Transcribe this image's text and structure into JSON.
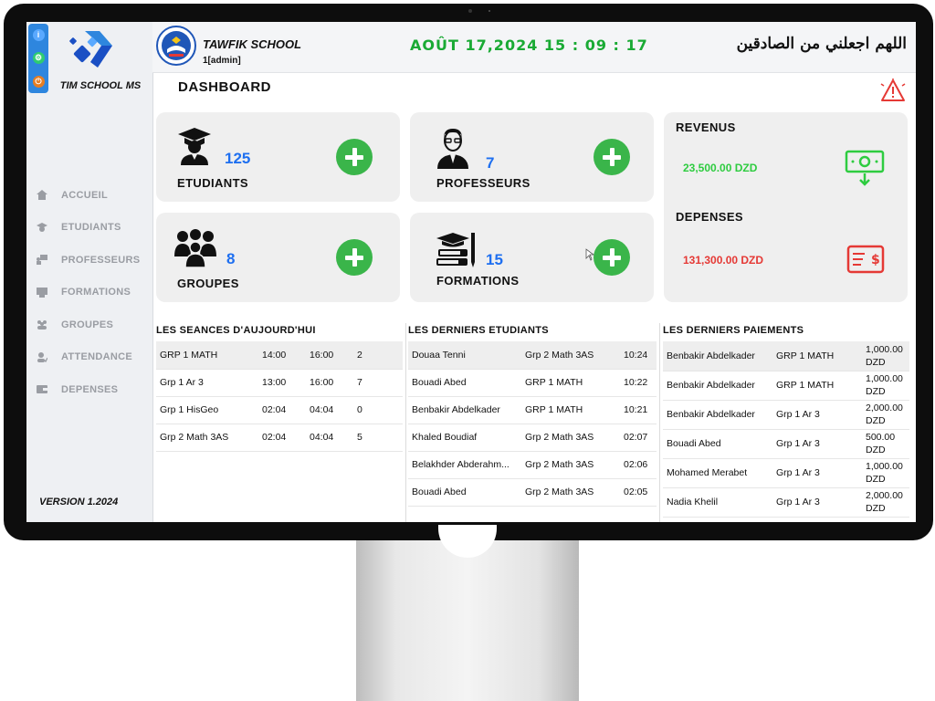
{
  "sidebar": {
    "brand": "TIM SCHOOL MS",
    "version": "VERSION 1.2024",
    "window_controls": [
      {
        "icon": "info-icon",
        "glyph": "i",
        "color": "#2e86de"
      },
      {
        "icon": "settings-icon",
        "glyph": "⚙",
        "color": "#2ecc71"
      },
      {
        "icon": "power-icon",
        "glyph": "⏻",
        "color": "#e67e22"
      }
    ],
    "items": [
      {
        "label": "ACCUEIL",
        "icon": "home-icon"
      },
      {
        "label": "ETUDIANTS",
        "icon": "student-icon"
      },
      {
        "label": "PROFESSEURS",
        "icon": "teacher-icon"
      },
      {
        "label": "FORMATIONS",
        "icon": "formation-icon"
      },
      {
        "label": "GROUPES",
        "icon": "groups-icon"
      },
      {
        "label": "ATTENDANCE",
        "icon": "attendance-icon"
      },
      {
        "label": "DEPENSES",
        "icon": "expenses-icon"
      }
    ]
  },
  "header": {
    "school_name": "TAWFIK SCHOOL",
    "user": "1[admin]",
    "datetime": "AOÛT 17,2024 15 : 09 : 17",
    "prayer": "اللهم اجعلني من الصادقين"
  },
  "page": {
    "title": "DASHBOARD"
  },
  "stats": {
    "students": {
      "count": "125",
      "label": "ETUDIANTS"
    },
    "teachers": {
      "count": "7",
      "label": "PROFESSEURS"
    },
    "groups": {
      "count": "8",
      "label": "GROUPES"
    },
    "formations": {
      "count": "15",
      "label": "FORMATIONS"
    }
  },
  "finance": {
    "revenue_title": "REVENUS",
    "revenue_value": "23,500.00 DZD",
    "expenses_title": "DEPENSES",
    "expenses_value": "131,300.00 DZD",
    "colors": {
      "revenue": "#2ecc40",
      "expenses": "#e53935"
    }
  },
  "sessions": {
    "title": "LES SEANCES D'AUJOURD'HUI",
    "rows": [
      [
        "GRP 1 MATH",
        "14:00",
        "16:00",
        "2"
      ],
      [
        "Grp 1 Ar 3",
        "13:00",
        "16:00",
        "7"
      ],
      [
        "Grp 1 HisGeo",
        "02:04",
        "04:04",
        "0"
      ],
      [
        "Grp 2 Math 3AS",
        "02:04",
        "04:04",
        "5"
      ]
    ]
  },
  "latest_students": {
    "title": "LES DERNIERS ETUDIANTS",
    "rows": [
      [
        "Douaa Tenni",
        "Grp 2 Math 3AS",
        "10:24"
      ],
      [
        "Bouadi Abed",
        "GRP 1 MATH",
        "10:22"
      ],
      [
        "Benbakir Abdelkader",
        "GRP 1 MATH",
        "10:21"
      ],
      [
        "Khaled Boudiaf",
        "Grp 2 Math 3AS",
        "02:07"
      ],
      [
        "Belakhder Abderahm...",
        "Grp 2 Math 3AS",
        "02:06"
      ],
      [
        "Bouadi Abed",
        "Grp 2 Math 3AS",
        "02:05"
      ]
    ]
  },
  "latest_payments": {
    "title": "LES DERNIERS PAIEMENTS",
    "rows": [
      [
        "Benbakir Abdelkader",
        "GRP 1 MATH",
        "1,000.00",
        "DZD"
      ],
      [
        "Benbakir Abdelkader",
        "GRP 1 MATH",
        "1,000.00",
        "DZD"
      ],
      [
        "Benbakir Abdelkader",
        "Grp 1 Ar 3",
        "2,000.00",
        "DZD"
      ],
      [
        "Bouadi Abed",
        "Grp 1 Ar 3",
        "500.00",
        "DZD"
      ],
      [
        "Mohamed Merabet",
        "Grp 1 Ar 3",
        "1,000.00",
        "DZD"
      ],
      [
        "Nadia Khelil",
        "Grp 1 Ar 3",
        "2,000.00",
        "DZD"
      ]
    ]
  }
}
